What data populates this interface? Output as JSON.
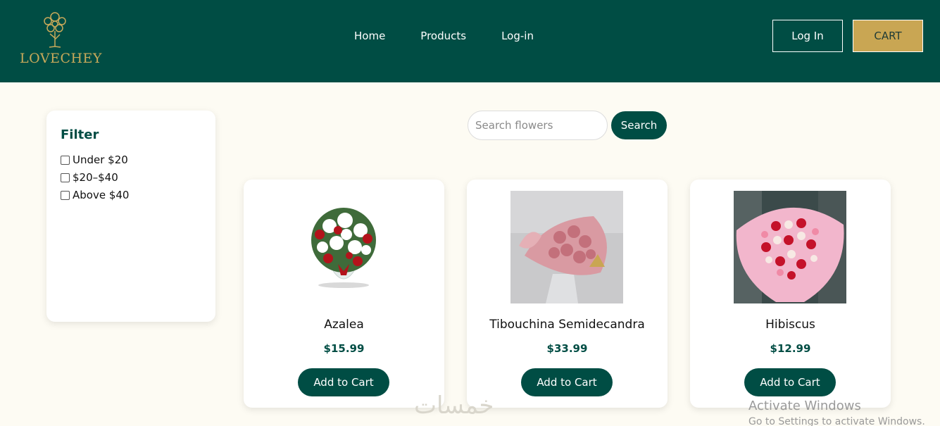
{
  "header": {
    "logo_text": "LOVECHEY",
    "nav": [
      "Home",
      "Products",
      "Log-in"
    ],
    "login_label": "Log In",
    "cart_label": "CART"
  },
  "filter": {
    "title": "Filter",
    "options": [
      "Under $20",
      "$20–$40",
      "Above $40"
    ]
  },
  "search": {
    "placeholder": "Search flowers",
    "button_label": "Search"
  },
  "products": [
    {
      "name": "Azalea",
      "price": "$15.99",
      "button": "Add to Cart"
    },
    {
      "name": "Tibouchina Semidecandra",
      "price": "$33.99",
      "button": "Add to Cart"
    },
    {
      "name": "Hibiscus",
      "price": "$12.99",
      "button": "Add to Cart"
    }
  ],
  "overlay": {
    "watermark": "خمسات",
    "activate_title": "Activate Windows",
    "activate_sub": "Go to Settings to activate Windows."
  },
  "colors": {
    "header_bg": "#004d44",
    "accent_gold": "#c9a653",
    "page_bg": "#fdfbf3"
  }
}
